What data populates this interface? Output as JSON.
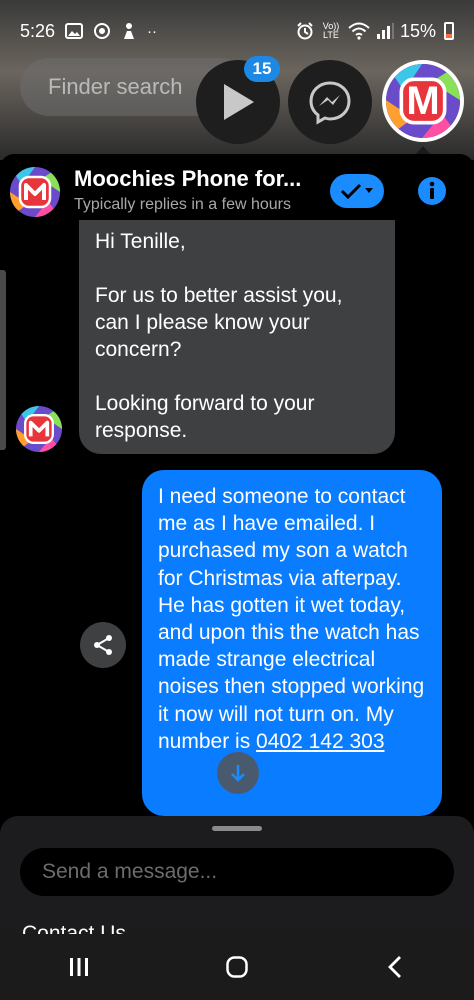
{
  "status_bar": {
    "time": "5:26",
    "network": "Vo)) LTE",
    "battery": "15%"
  },
  "bubbles_overlay": {
    "finder_placeholder": "Finder search",
    "video_badge": "15",
    "moochies_letter": "M"
  },
  "chat": {
    "title": "Moochies Phone for...",
    "subtitle": "Typically replies in a few hours",
    "incoming_message": {
      "lines": [
        "Hi Tenille,",
        "For us to better assist you, can I please know your concern?",
        "Looking forward to your response."
      ]
    },
    "outgoing_message": {
      "text": "I need someone to contact me as I have emailed. I purchased my son a watch for Christmas via afterpay. He has gotten it wet today, and upon this the watch has made strange electrical noises then stopped working it now will not turn on. My number is ",
      "phone": "0402 142 303"
    }
  },
  "composer": {
    "placeholder": "Send a message...",
    "contact_us": "Contact Us"
  },
  "colors": {
    "accent": "#0a7cff",
    "incoming_bubble": "#3e4042",
    "check_button": "#1a8cff"
  }
}
